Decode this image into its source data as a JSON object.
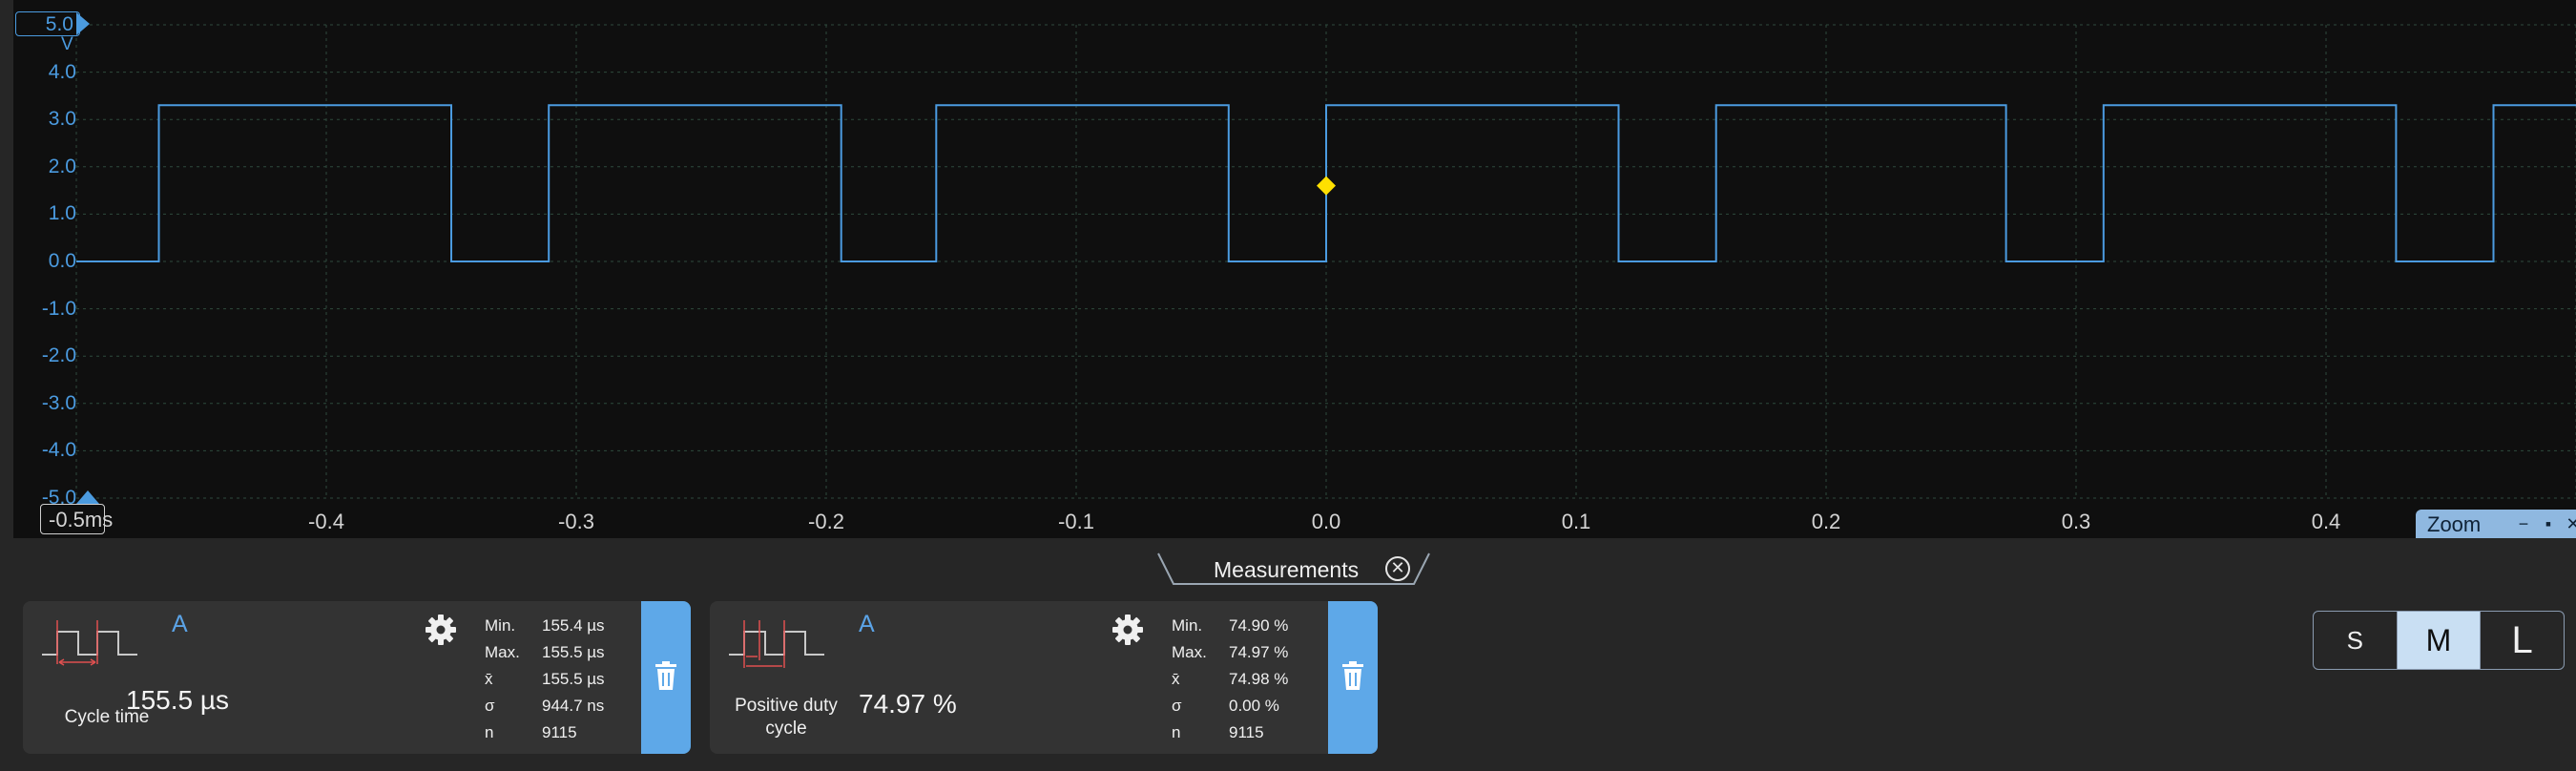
{
  "scope": {
    "y_box": "5.0",
    "y_unit": "V",
    "y_ticks": [
      "4.0",
      "3.0",
      "2.0",
      "1.0",
      "0.0",
      "-1.0",
      "-2.0",
      "-3.0",
      "-4.0",
      "-5.0"
    ],
    "x_box": "-0.5ms",
    "x_ticks": [
      "-0.4",
      "-0.3",
      "-0.2",
      "-0.1",
      "0.0",
      "0.1",
      "0.2",
      "0.3",
      "0.4"
    ],
    "zoom_label": "Zoom",
    "zoom_buttons": [
      "−",
      "▪",
      "✕"
    ],
    "colors": {
      "trace": "#4b9be0",
      "grid": "#2f4a3d",
      "trigger": "#ffe000",
      "background": "#0f0f0f"
    }
  },
  "chart_data": {
    "type": "line",
    "title": "",
    "xlabel": "ms",
    "ylabel": "V",
    "xlim": [
      -0.5,
      0.5
    ],
    "ylim": [
      -5.0,
      5.0
    ],
    "grid": true,
    "series": [
      {
        "x": [
          -0.5,
          -0.467,
          -0.467,
          -0.35,
          -0.35,
          -0.311,
          -0.311,
          -0.194,
          -0.194,
          -0.156,
          -0.156,
          -0.039,
          -0.039,
          0.0,
          0.0,
          0.117,
          0.117,
          0.156,
          0.156,
          0.272,
          0.272,
          0.311,
          0.311,
          0.428,
          0.428,
          0.467,
          0.467,
          0.5
        ],
        "y": [
          0,
          0,
          3.3,
          3.3,
          0,
          0,
          3.3,
          3.3,
          0,
          0,
          3.3,
          3.3,
          0,
          0,
          3.3,
          3.3,
          0,
          0,
          3.3,
          3.3,
          0,
          0,
          3.3,
          3.3,
          0,
          0,
          3.3,
          3.3
        ]
      }
    ],
    "trigger": {
      "x": 0.0,
      "y": 1.6
    }
  },
  "measurements": {
    "tab_label": "Measurements",
    "close_icon": "close-circle-icon",
    "cards": [
      {
        "channel": "A",
        "name": "Cycle time",
        "value": "155.5 µs",
        "stats": [
          {
            "k": "Min.",
            "v": "155.4 µs"
          },
          {
            "k": "Max.",
            "v": "155.5 µs"
          },
          {
            "k": "x̄",
            "v": "155.5 µs"
          },
          {
            "k": "σ",
            "v": "944.7 ns"
          },
          {
            "k": "n",
            "v": "9115"
          }
        ]
      },
      {
        "channel": "A",
        "name": "Positive duty cycle",
        "value": "74.97 %",
        "stats": [
          {
            "k": "Min.",
            "v": "74.90 %"
          },
          {
            "k": "Max.",
            "v": "74.97 %"
          },
          {
            "k": "x̄",
            "v": "74.98 %"
          },
          {
            "k": "σ",
            "v": "0.00 %"
          },
          {
            "k": "n",
            "v": "9115"
          }
        ]
      }
    ]
  },
  "size_buttons": [
    {
      "label": "S",
      "active": false
    },
    {
      "label": "M",
      "active": true
    },
    {
      "label": "L",
      "active": false
    }
  ]
}
